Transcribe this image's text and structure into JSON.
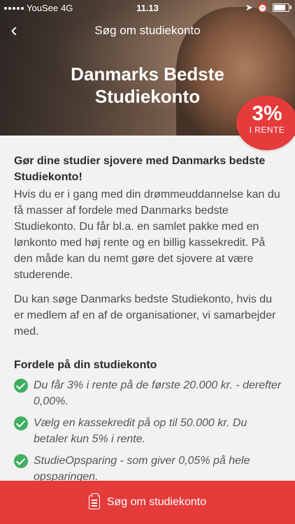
{
  "status_bar": {
    "carrier": "YouSee",
    "network": "4G",
    "time": "11.13"
  },
  "nav": {
    "title": "Søg om studiekonto",
    "back_icon": "chevron-left-icon"
  },
  "hero": {
    "title": "Danmarks Bedste Studiekonto",
    "badge_percent": "3%",
    "badge_label": "I RENTE"
  },
  "content": {
    "intro_heading": "Gør dine studier sjovere med Danmarks bedste Studiekonto!",
    "paragraph_1": "Hvis du er i gang med din drømmeuddannelse kan du få masser af fordele med Danmarks bedste Studiekonto. Du får bl.a. en samlet pakke med en lønkonto med høj rente og en billig kassekredit. På den måde kan du nemt gøre det sjovere at være studerende.",
    "paragraph_2": "Du kan søge Danmarks bedste Studiekonto, hvis du er medlem af en af de organisationer, vi samarbejder med.",
    "benefits_heading": "Fordele på din studiekonto",
    "benefits": [
      "Du får 3% i rente på de første 20.000 kr. - derefter 0,00%.",
      "Vælg en kassekredit på op til 50.000 kr. Du betaler kun 5% i rente.",
      "StudieOpsparing - som giver 0,05% på hele opsparingen."
    ]
  },
  "cta": {
    "label": "Søg om studiekonto",
    "icon": "clipboard-icon"
  },
  "colors": {
    "accent": "#e53b3b",
    "check": "#3fae5e"
  }
}
